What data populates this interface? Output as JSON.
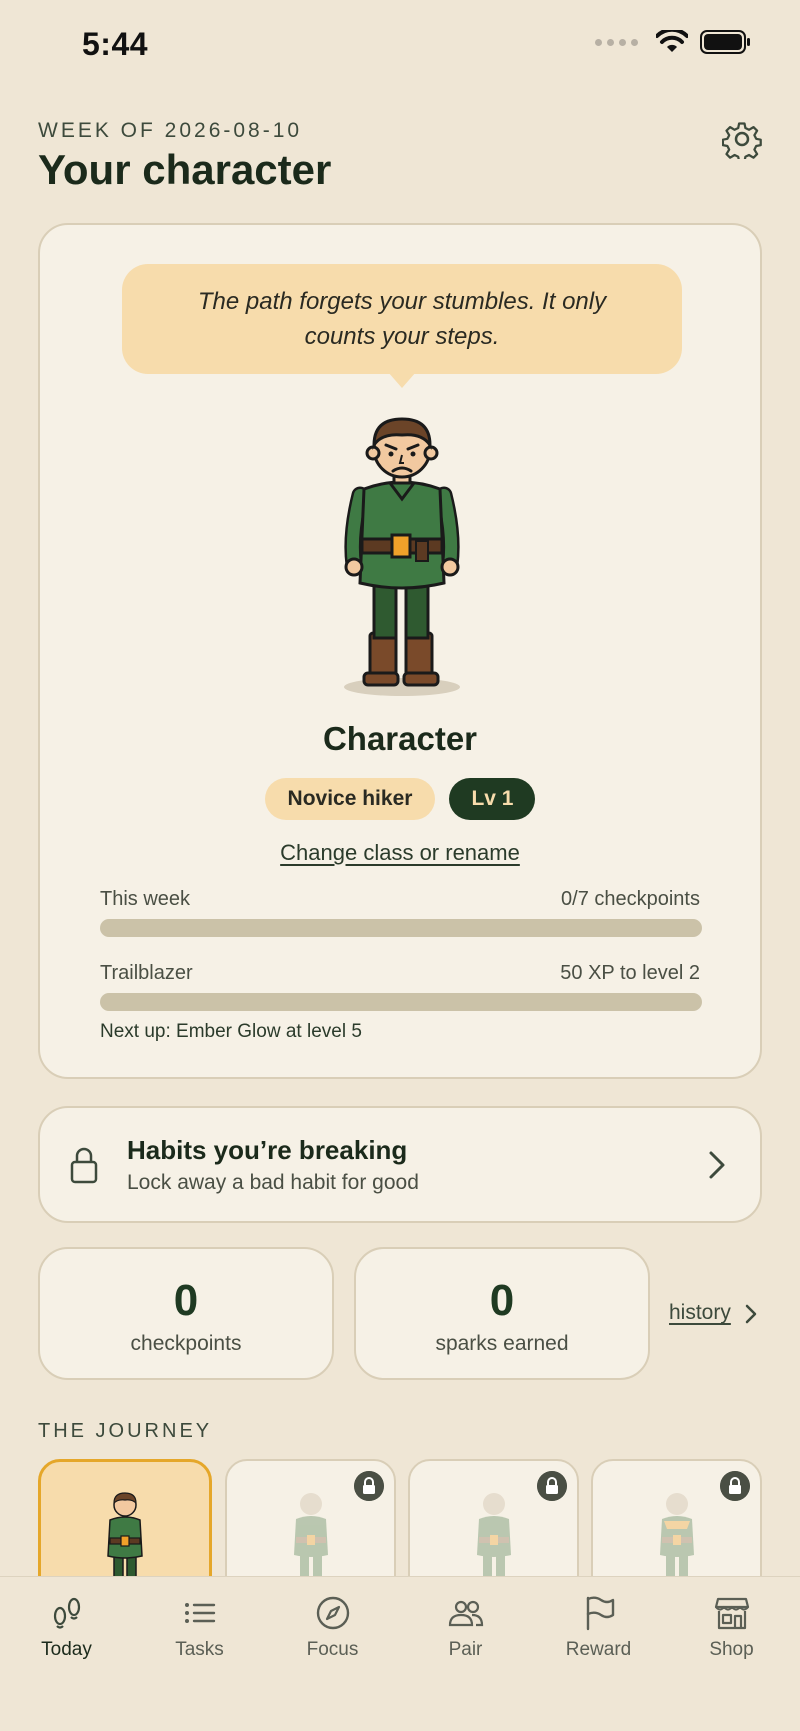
{
  "status_bar": {
    "time": "5:44"
  },
  "header": {
    "week_label": "WEEK OF 2026-08-10",
    "title": "Your character",
    "settings_icon": "gear-icon"
  },
  "character": {
    "quote": "The path forgets your stumbles. It only counts your steps.",
    "name": "Character",
    "class_badge": "Novice hiker",
    "level_badge": "Lv 1",
    "rename_link": "Change class or rename",
    "week_progress": {
      "label": "This week",
      "value_text": "0/7 checkpoints",
      "fraction": 0
    },
    "xp_progress": {
      "label": "Trailblazer",
      "value_text": "50 XP to level 2",
      "fraction": 0
    },
    "next_up": "Next up: Ember Glow at level 5"
  },
  "habits": {
    "title": "Habits you’re breaking",
    "subtitle": "Lock away a bad habit for good",
    "icon": "lock-icon"
  },
  "stats": [
    {
      "value": "0",
      "label": "checkpoints"
    },
    {
      "value": "0",
      "label": "sparks earned"
    }
  ],
  "history_link": "history",
  "journey": {
    "label": "THE JOURNEY",
    "stages": [
      {
        "locked": false,
        "active": true
      },
      {
        "locked": true,
        "active": false
      },
      {
        "locked": true,
        "active": false
      },
      {
        "locked": true,
        "active": false
      }
    ]
  },
  "tabs": [
    {
      "label": "Today",
      "icon": "footsteps-icon",
      "active": true
    },
    {
      "label": "Tasks",
      "icon": "list-icon",
      "active": false
    },
    {
      "label": "Focus",
      "icon": "compass-icon",
      "active": false
    },
    {
      "label": "Pair",
      "icon": "people-icon",
      "active": false
    },
    {
      "label": "Reward",
      "icon": "flag-icon",
      "active": false
    },
    {
      "label": "Shop",
      "icon": "store-icon",
      "active": false
    }
  ],
  "colors": {
    "background": "#efe6d5",
    "card": "#f6f1e6",
    "accent_cream": "#f7dcac",
    "accent_green": "#1f3a22",
    "accent_orange": "#e5a72a"
  }
}
